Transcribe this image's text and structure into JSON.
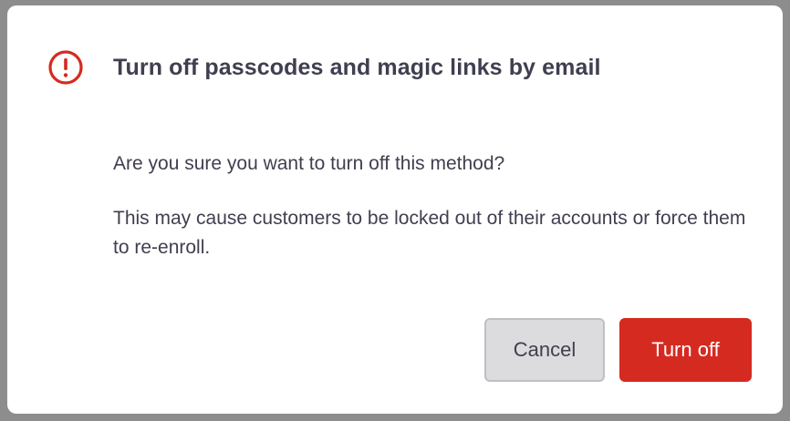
{
  "dialog": {
    "title": "Turn off passcodes and magic links by email",
    "icon": "alert-circle-icon",
    "question": "Are you sure you want to turn off this method?",
    "warning": "This may cause customers to be locked out of their accounts or force them to re-enroll.",
    "cancel_label": "Cancel",
    "confirm_label": "Turn off"
  },
  "colors": {
    "accent_danger": "#d52a20",
    "text": "#3f3f50",
    "secondary_button_bg": "#dcdcde"
  }
}
